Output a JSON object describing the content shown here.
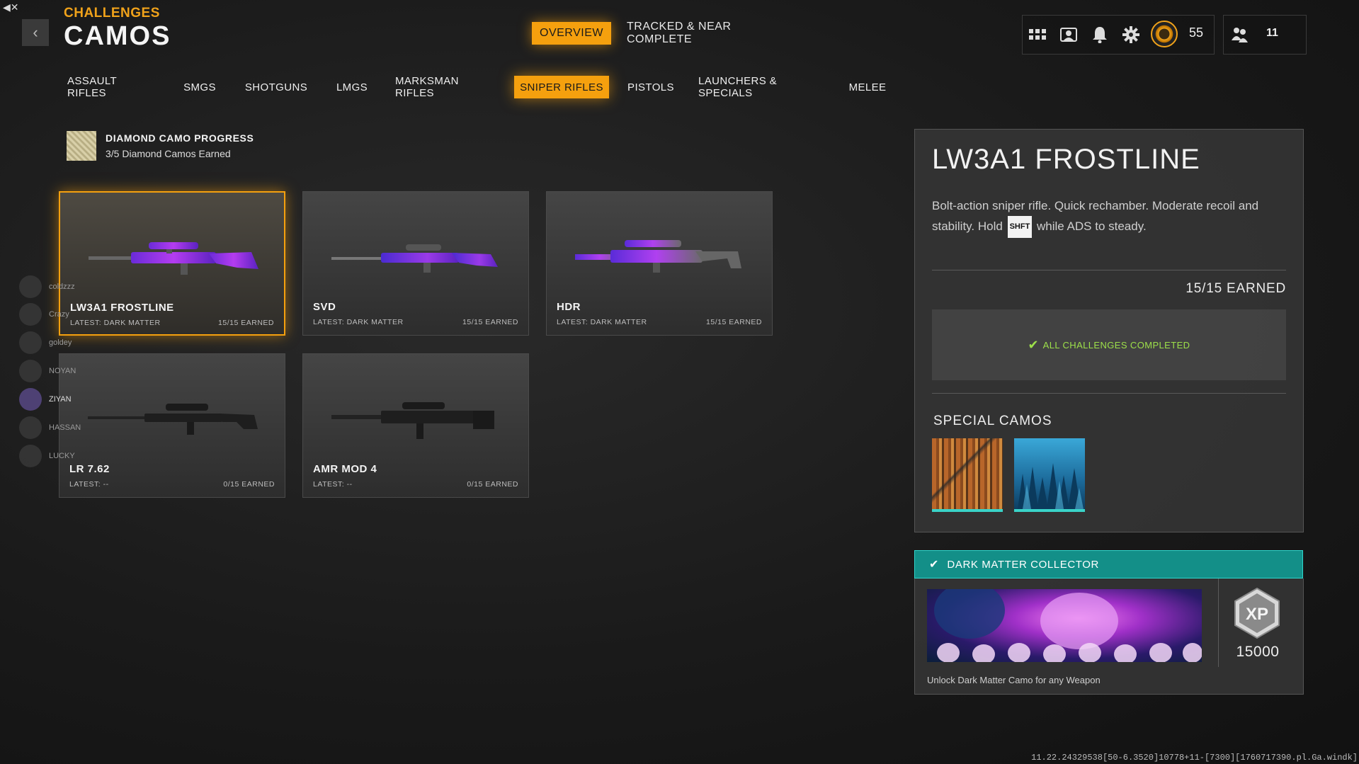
{
  "header": {
    "breadcrumb": "CHALLENGES",
    "title": "CAMOS",
    "top_tabs": [
      {
        "label": "OVERVIEW",
        "active": true
      },
      {
        "label": "TRACKED & NEAR COMPLETE",
        "active": false
      }
    ],
    "level": "55",
    "party_count": "11"
  },
  "categories": [
    {
      "label": "ASSAULT RIFLES"
    },
    {
      "label": "SMGS"
    },
    {
      "label": "SHOTGUNS"
    },
    {
      "label": "LMGS"
    },
    {
      "label": "MARKSMAN RIFLES"
    },
    {
      "label": "SNIPER RIFLES",
      "active": true
    },
    {
      "label": "PISTOLS"
    },
    {
      "label": "LAUNCHERS & SPECIALS"
    },
    {
      "label": "MELEE"
    }
  ],
  "diamond_progress": {
    "title": "DIAMOND CAMO PROGRESS",
    "subtitle": "3/5 Diamond Camos Earned"
  },
  "weapons": [
    {
      "name": "LW3A1 FROSTLINE",
      "latest": "LATEST: DARK MATTER",
      "earned": "15/15 EARNED",
      "camo": "dark-matter"
    },
    {
      "name": "SVD",
      "latest": "LATEST: DARK MATTER",
      "earned": "15/15 EARNED",
      "camo": "dark-matter"
    },
    {
      "name": "HDR",
      "latest": "LATEST: DARK MATTER",
      "earned": "15/15 EARNED",
      "camo": "dark-matter"
    },
    {
      "name": "LR 7.62",
      "latest": "LATEST: --",
      "earned": "0/15 EARNED",
      "camo": "none"
    },
    {
      "name": "AMR MOD 4",
      "latest": "LATEST: --",
      "earned": "0/15 EARNED",
      "camo": "none"
    }
  ],
  "detail": {
    "title": "LW3A1 FROSTLINE",
    "desc_before": "Bolt-action sniper rifle.  Quick rechamber. Moderate recoil and stability.  Hold ",
    "key": "SHFT",
    "desc_after": " while ADS to steady.",
    "earned": "15/15 EARNED",
    "complete": "ALL CHALLENGES COMPLETED",
    "special_title": "SPECIAL CAMOS"
  },
  "collector": {
    "title": "DARK MATTER COLLECTOR",
    "xp": "15000",
    "xp_label": "XP",
    "desc": "Unlock Dark Matter Camo for any Weapon"
  },
  "party": [
    {
      "name": "coldzzz"
    },
    {
      "name": "Crazy"
    },
    {
      "name": "goldey"
    },
    {
      "name": "NOYAN"
    },
    {
      "name": "ZIYAN"
    },
    {
      "name": "HASSAN"
    },
    {
      "name": "LUCKY"
    }
  ],
  "build_string": "11.22.24329538[50-6.3520]10778+11-[7300][1760717390.pl.Ga.windk]",
  "colors": {
    "accent": "#f5a00e",
    "teal": "#138f88",
    "success": "#9de04a"
  }
}
